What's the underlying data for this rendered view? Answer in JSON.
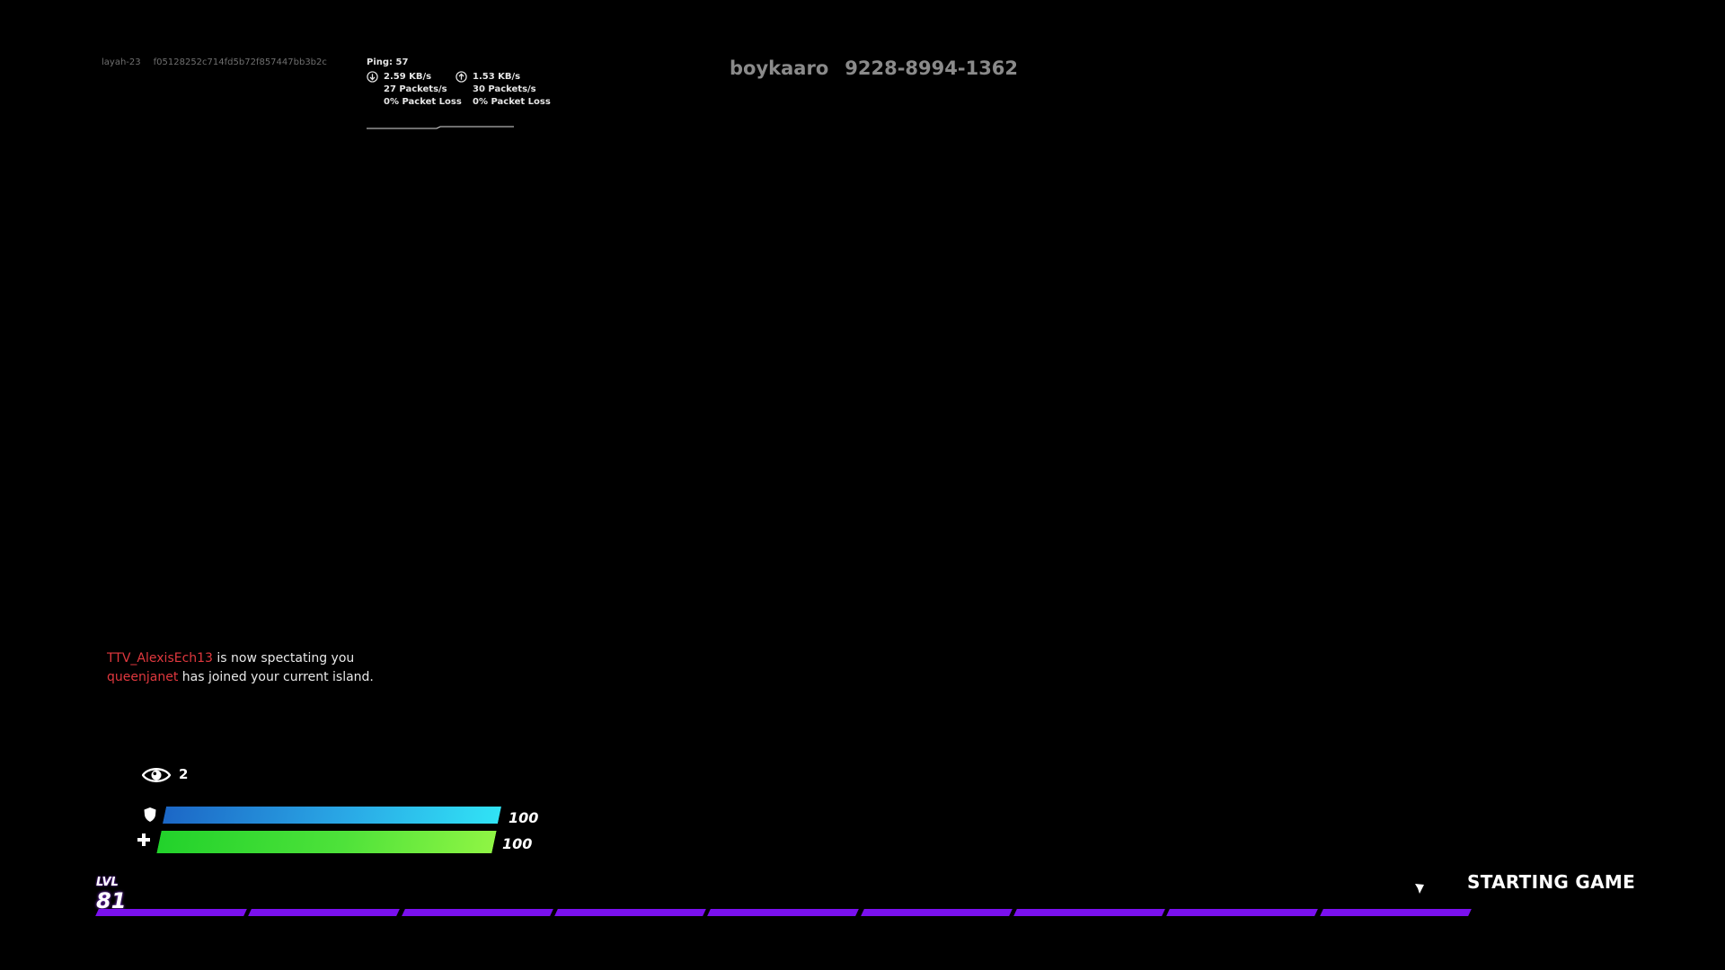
{
  "session": {
    "user_id": "layah-23",
    "session_hash": "f05128252c714fd5b72f857447bb3b2c"
  },
  "net_stats": {
    "ping_label": "Ping: 57",
    "download": {
      "icon": "download-arrow-icon",
      "rate": "2.59 KB/s",
      "packets": "27 Packets/s",
      "loss": "0% Packet Loss"
    },
    "upload": {
      "icon": "upload-arrow-icon",
      "rate": "1.53 KB/s",
      "packets": "30 Packets/s",
      "loss": "0% Packet Loss"
    }
  },
  "island": {
    "player_name": "boykaaro",
    "island_code": "9228-8994-1362"
  },
  "feed": [
    {
      "who": "TTV_AlexisEch13",
      "message": " is now spectating you"
    },
    {
      "who": "queenjanet",
      "message": " has joined your current island."
    }
  ],
  "spectators": {
    "icon": "eye-icon",
    "count": "2"
  },
  "shield": {
    "icon": "shield-icon",
    "value": "100",
    "fraction": 1.0,
    "color": "#31e3f5"
  },
  "health": {
    "icon": "plus-icon",
    "value": "100",
    "fraction": 1.0,
    "color": "#8ff544"
  },
  "level": {
    "label": "LVL",
    "number": "81"
  },
  "xp": {
    "segments_total": 9,
    "segments_filled": 9,
    "color": "#7a10ee"
  },
  "status": {
    "icon": "marker-icon",
    "text": "STARTING GAME"
  },
  "colors": {
    "background": "#000000",
    "player_name": "#e0383e",
    "xp_purple": "#7a10ee"
  }
}
